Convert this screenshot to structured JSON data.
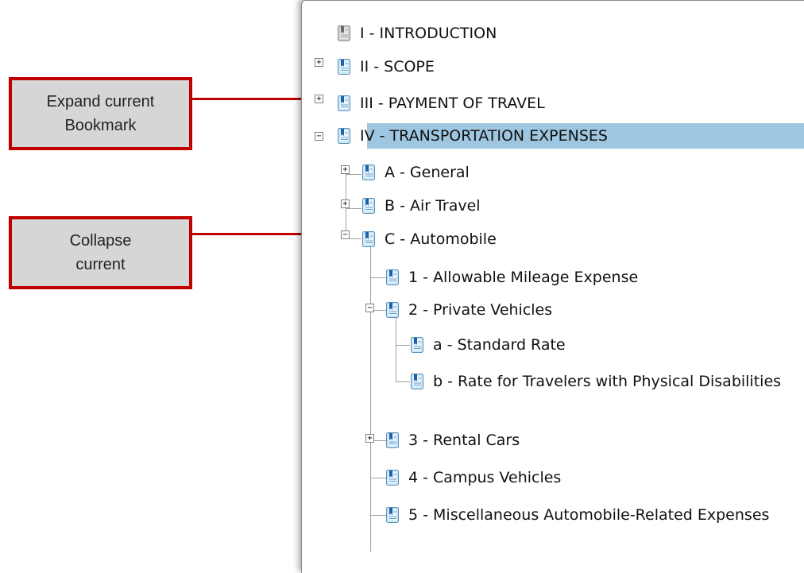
{
  "callouts": {
    "expand": "Expand current\nBookmark",
    "collapse": "Collapse\ncurrent"
  },
  "bookmarks": {
    "intro": "I - INTRODUCTION",
    "scope": "II - SCOPE",
    "payment": "III - PAYMENT OF TRAVEL",
    "transport": "IV - TRANSPORTATION EXPENSES",
    "general": "A - General",
    "air": "B - Air Travel",
    "auto": "C - Automobile",
    "mileage": "1 - Allowable Mileage Expense",
    "private": "2 - Private Vehicles",
    "standard": "a - Standard Rate",
    "disabilities": "b - Rate for Travelers with Physical Disabilities",
    "rental": "3 - Rental Cars",
    "campus": "4 - Campus Vehicles",
    "misc": "5 - Miscellaneous Automobile-Related Expenses"
  },
  "toggles": {
    "plus": "+",
    "minus": "−"
  },
  "colors": {
    "selection": "#9ec6e0",
    "callout_border": "#c00000",
    "callout_fill": "#d6d6d6"
  }
}
